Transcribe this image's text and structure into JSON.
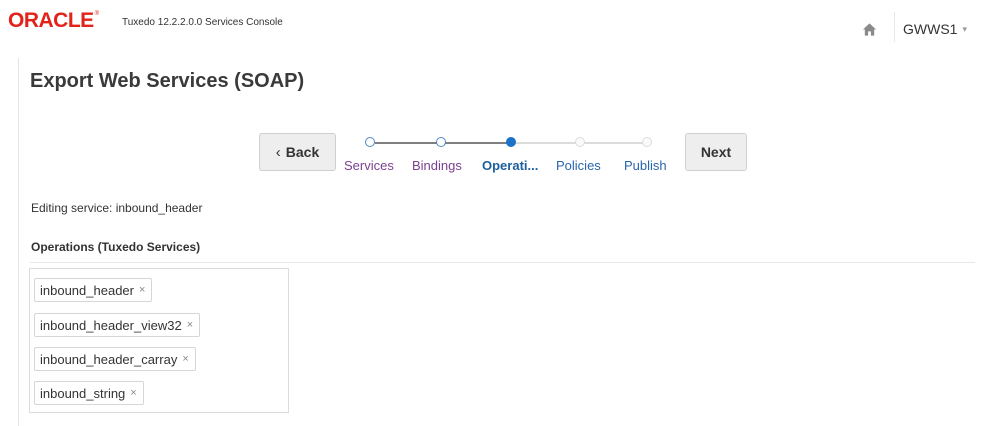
{
  "header": {
    "logo_text": "ORACLE",
    "logo_tm": "®",
    "app_title": "Tuxedo 12.2.2.0.0 Services Console",
    "home_icon": "home-icon",
    "user_name": "GWWS1",
    "user_caret": "▾"
  },
  "page": {
    "title": "Export Web Services (SOAP)"
  },
  "wizard": {
    "back_label": "Back",
    "back_icon": "‹",
    "next_label": "Next",
    "current_step": 2,
    "steps": [
      {
        "label": "Services",
        "state": "visited"
      },
      {
        "label": "Bindings",
        "state": "visited"
      },
      {
        "label": "Operati...",
        "state": "current"
      },
      {
        "label": "Policies",
        "state": "todo"
      },
      {
        "label": "Publish",
        "state": "todo"
      }
    ]
  },
  "editing_text": "Editing service: inbound_header",
  "operations": {
    "title": "Operations (Tuxedo Services)",
    "remove_icon": "×",
    "items": [
      "inbound_header",
      "inbound_header_view32",
      "inbound_header_carray",
      "inbound_string"
    ]
  },
  "colors": {
    "oracle_red": "#e2231a",
    "visited_link": "#7b3f91",
    "current_step": "#1b73c8",
    "todo_link": "#2a66ad"
  }
}
